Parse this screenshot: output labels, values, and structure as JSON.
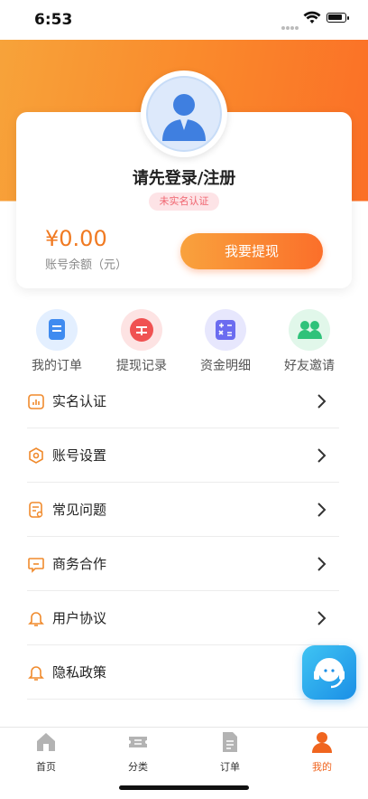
{
  "status_bar": {
    "time": "6:53"
  },
  "profile": {
    "login_prompt": "请先登录/注册",
    "verify_badge": "未实名认证",
    "balance": "¥0.00",
    "balance_label": "账号余额（元）",
    "withdraw_button": "我要提现"
  },
  "quick_actions": [
    {
      "label": "我的订单",
      "icon": "order-icon",
      "color": "#3f8bf0"
    },
    {
      "label": "提现记录",
      "icon": "withdraw-record-icon",
      "color": "#f05252"
    },
    {
      "label": "资金明细",
      "icon": "calculator-icon",
      "color": "#6b6cf0"
    },
    {
      "label": "好友邀请",
      "icon": "friends-icon",
      "color": "#2fc27a"
    }
  ],
  "menu": [
    {
      "label": "实名认证",
      "icon": "chart-icon"
    },
    {
      "label": "账号设置",
      "icon": "settings-icon"
    },
    {
      "label": "常见问题",
      "icon": "faq-icon"
    },
    {
      "label": "商务合作",
      "icon": "message-icon"
    },
    {
      "label": "用户协议",
      "icon": "bell-icon"
    },
    {
      "label": "隐私政策",
      "icon": "bell-icon"
    }
  ],
  "tabs": [
    {
      "label": "首页",
      "icon": "home-icon",
      "active": false
    },
    {
      "label": "分类",
      "icon": "ticket-icon",
      "active": false
    },
    {
      "label": "订单",
      "icon": "document-icon",
      "active": false
    },
    {
      "label": "我的",
      "icon": "user-icon",
      "active": true
    }
  ],
  "colors": {
    "accent": "#fb6f26",
    "accent_light": "#f7a33a",
    "badge_text": "#f0646f",
    "service": "#1b8fe6"
  }
}
